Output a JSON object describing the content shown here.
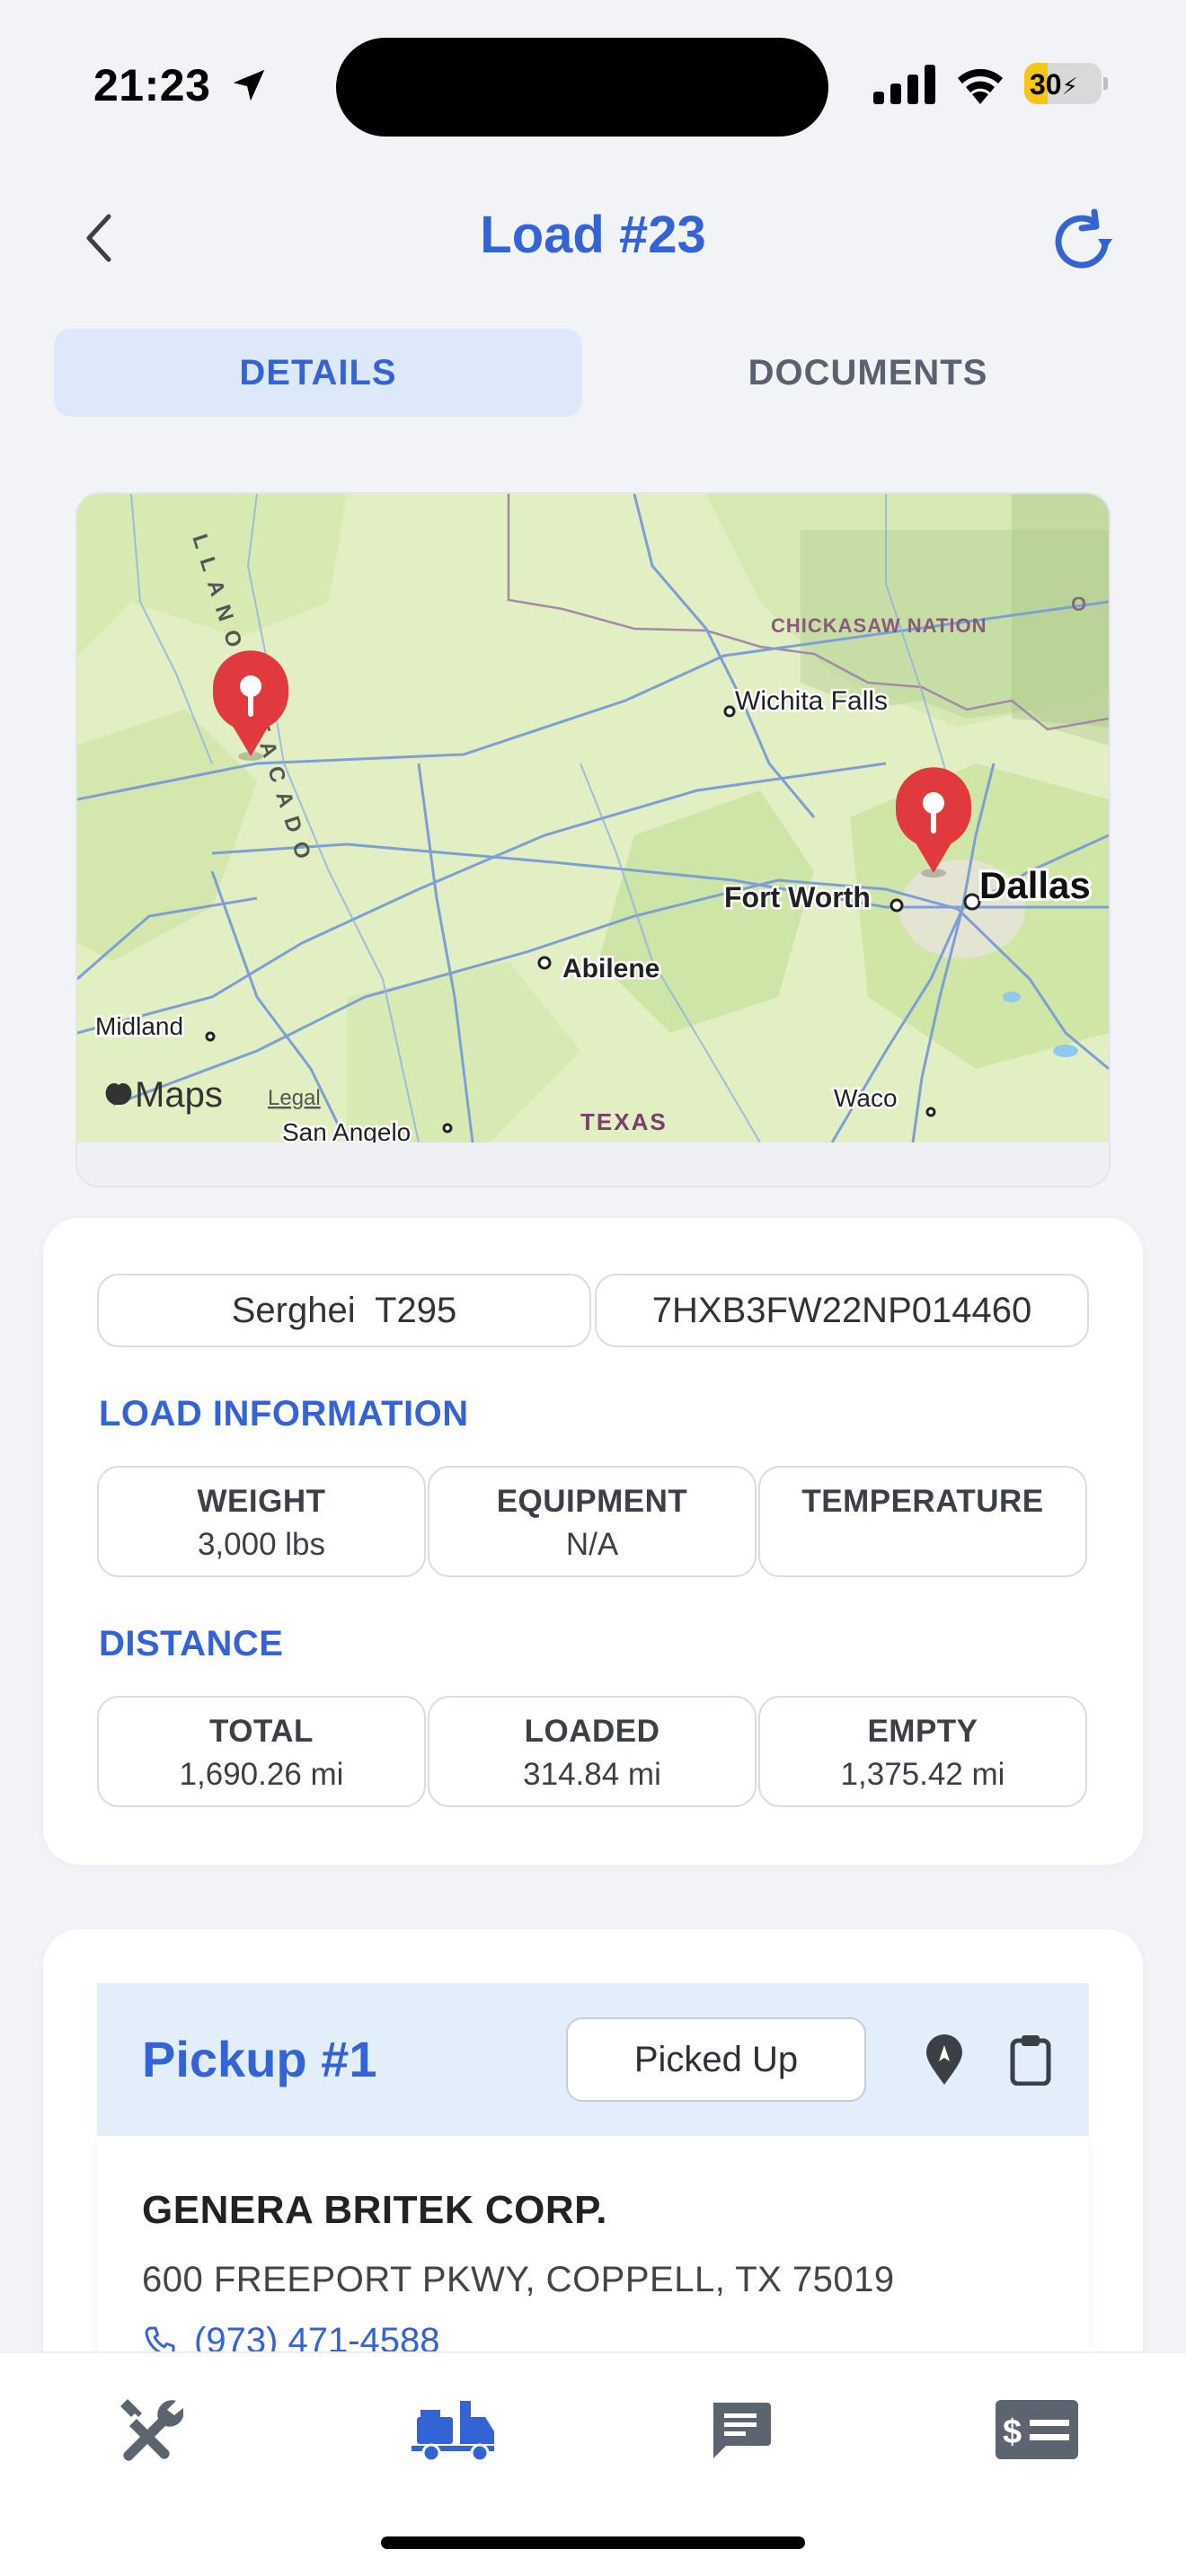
{
  "status_bar": {
    "time": "21:23",
    "battery": "30",
    "battery_level": 0.3
  },
  "header": {
    "title": "Load #23"
  },
  "tabs": [
    {
      "label": "DETAILS",
      "active": true
    },
    {
      "label": "DOCUMENTS",
      "active": false
    }
  ],
  "map": {
    "labels": {
      "region_top": "CHICKASAW NATION",
      "llano": "LLANO ESTACADO",
      "wichita": "Wichita Falls",
      "fort_worth": "Fort Worth",
      "dallas": "Dallas",
      "abilene": "Abilene",
      "midland": "Midland",
      "waco": "Waco",
      "san_angelo": "San Angelo",
      "texas": "TEXAS",
      "maps_brand": "Maps",
      "legal": "Legal",
      "edge_o": "O"
    }
  },
  "load": {
    "driver": "Serghei  T295",
    "vin": "7HXB3FW22NP014460",
    "info_label": "LOAD INFORMATION",
    "info": [
      {
        "label": "WEIGHT",
        "value": "3,000 lbs"
      },
      {
        "label": "EQUIPMENT",
        "value": "N/A"
      },
      {
        "label": "TEMPERATURE",
        "value": ""
      }
    ],
    "distance_label": "DISTANCE",
    "distance": [
      {
        "label": "TOTAL",
        "value": "1,690.26 mi"
      },
      {
        "label": "LOADED",
        "value": "314.84 mi"
      },
      {
        "label": "EMPTY",
        "value": "1,375.42 mi"
      }
    ]
  },
  "pickup": {
    "title": "Pickup #1",
    "status": "Picked Up",
    "company": "GENERA BRITEK CORP.",
    "address": "600 FREEPORT PKWY, COPPELL, TX 75019",
    "phone": "(973) 471-4588"
  },
  "tabbar": {
    "icons": [
      "tools-icon",
      "truck-load-icon",
      "chat-icon",
      "billing-icon"
    ],
    "active_index": 1
  },
  "colors": {
    "accent": "#3463d6",
    "tab_active_bg": "#dde9fb",
    "pickup_head_bg": "#e3eefb"
  }
}
